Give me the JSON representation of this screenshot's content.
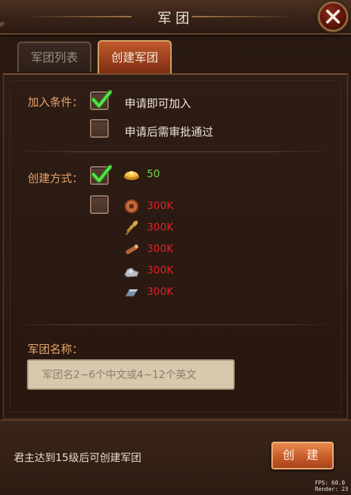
{
  "window": {
    "title": "军团"
  },
  "tabs": [
    {
      "label": "军团列表",
      "active": false
    },
    {
      "label": "创建军团",
      "active": true
    }
  ],
  "join_condition": {
    "label": "加入条件：",
    "options": [
      {
        "label": "申请即可加入",
        "checked": true
      },
      {
        "label": "申请后需审批通过",
        "checked": false
      }
    ]
  },
  "create_method": {
    "label": "创建方式：",
    "options": [
      {
        "checked": true,
        "costs": [
          {
            "icon": "gold-ingot-icon",
            "value": "50",
            "color": "#6ddc4a"
          }
        ]
      },
      {
        "checked": false,
        "costs": [
          {
            "icon": "copper-coin-icon",
            "value": "300K",
            "color": "#e02222"
          },
          {
            "icon": "wheat-icon",
            "value": "300K",
            "color": "#e02222"
          },
          {
            "icon": "wood-icon",
            "value": "300K",
            "color": "#e02222"
          },
          {
            "icon": "stone-icon",
            "value": "300K",
            "color": "#e02222"
          },
          {
            "icon": "iron-icon",
            "value": "300K",
            "color": "#e02222"
          }
        ]
      }
    ]
  },
  "legion_name": {
    "label": "军团名称：",
    "value": "",
    "placeholder": "军团名2~6个中文或4~12个英文"
  },
  "footer": {
    "note": "君主达到15级后可创建军团",
    "create_label": "创 建"
  },
  "debug": {
    "fps": "FPS: 60.0",
    "render": "Render:  23"
  },
  "colors": {
    "accent": "#c85c2a",
    "label": "#e8a46a",
    "insufficient": "#e02222",
    "sufficient": "#6ddc4a"
  }
}
